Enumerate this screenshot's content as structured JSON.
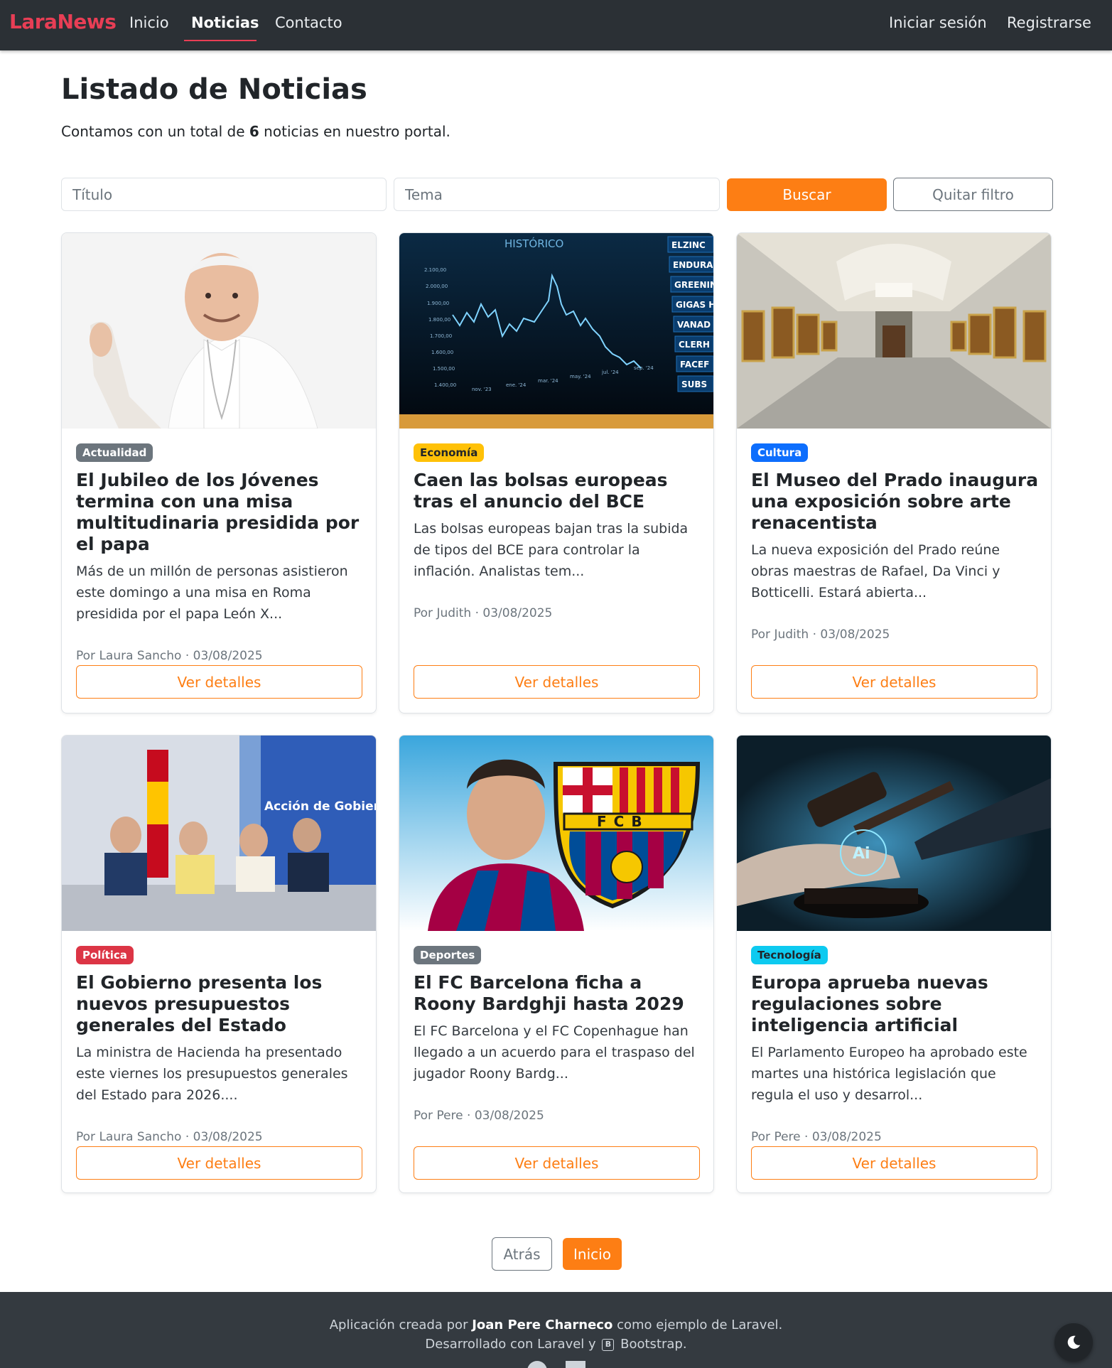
{
  "navbar": {
    "brand": "LaraNews",
    "links": [
      "Inicio",
      "Noticias",
      "Contacto"
    ],
    "active": "Noticias",
    "login": "Iniciar sesión",
    "register": "Registrarse",
    "accent_color": "#e83e55"
  },
  "header": {
    "title": "Listado de Noticias",
    "subtitle_before": "Contamos con un total de ",
    "count": "6",
    "subtitle_after": " noticias en nuestro portal."
  },
  "filter": {
    "title_placeholder": "Título",
    "topic_placeholder": "Tema",
    "search_label": "Buscar",
    "clear_label": "Quitar filtro"
  },
  "cards": [
    {
      "image": "pope-photo",
      "badge": "Actualidad",
      "badge_color": "#6c757d",
      "title": "El Jubileo de los Jóvenes termina con una misa multitudinaria presidida por el papa",
      "text": "Más de un millón de personas asistieron este domingo a una misa en Roma presidida por el papa León X...",
      "meta": "Por Laura Sancho · 03/08/2025",
      "button": "Ver detalles"
    },
    {
      "image": "stock-chart-photo",
      "badge": "Economía",
      "badge_color": "#ffc107",
      "title": "Caen las bolsas europeas tras el anuncio del BCE",
      "text": "Las bolsas europeas bajan tras la subida de tipos del BCE para controlar la inflación. Analistas tem...",
      "meta": "Por Judith · 03/08/2025",
      "button": "Ver detalles",
      "image_text": {
        "heading": "HISTÓRICO",
        "yticks": [
          "2.100,00",
          "2.000,00",
          "1.900,00",
          "1.800,00",
          "1.700,00",
          "1.600,00",
          "1.500,00",
          "1.400,00"
        ],
        "xticks": [
          "nov. '23",
          "ene. '24",
          "mar. '24",
          "may. '24",
          "jul. '24",
          "sep. '24"
        ],
        "tickers": [
          "ELZINC",
          "ENDURAN",
          "GREENIN",
          "GIGAS H",
          "VANAD",
          "CLERH",
          "FACEF",
          "SUBS"
        ]
      }
    },
    {
      "image": "museum-gallery-photo",
      "badge": "Cultura",
      "badge_color": "#0d6efd",
      "title": "El Museo del Prado inaugura una exposición sobre arte renacentista",
      "text": "La nueva exposición del Prado reúne obras maestras de Rafael, Da Vinci y Botticelli. Estará abierta...",
      "meta": "Por Judith · 03/08/2025",
      "button": "Ver detalles"
    },
    {
      "image": "government-press-photo",
      "badge": "Política",
      "badge_color": "#dc3545",
      "title": "El Gobierno presenta los nuevos presupuestos generales del Estado",
      "text": "La ministra de Hacienda ha presentado este viernes los presupuestos generales del Estado para 2026....",
      "meta": "Por Laura Sancho · 03/08/2025",
      "button": "Ver detalles",
      "image_text": {
        "sign": "Acción de Gobierno"
      }
    },
    {
      "image": "football-player-photo",
      "badge": "Deportes",
      "badge_color": "#6c757d",
      "title": "El FC Barcelona ficha a Roony Bardghji hasta 2029",
      "text": "El FC Barcelona y el FC Copenhague han llegado a un acuerdo para el traspaso del jugador Roony Bardg...",
      "meta": "Por Pere · 03/08/2025",
      "button": "Ver detalles",
      "image_text": {
        "crest": "FCB"
      }
    },
    {
      "image": "ai-gavel-photo",
      "badge": "Tecnología",
      "badge_color": "#0dcaf0",
      "title": "Europa aprueba nuevas regulaciones sobre inteligencia artificial",
      "text": "El Parlamento Europeo ha aprobado este martes una histórica legislación que regula el uso y desarrol...",
      "meta": "Por Pere · 03/08/2025",
      "button": "Ver detalles",
      "image_text": {
        "chip": "Ai"
      }
    }
  ],
  "pagination": {
    "back": "Atrás",
    "home": "Inicio"
  },
  "footer": {
    "line1_before": "Aplicación creada por ",
    "author": "Joan Pere Charneco",
    "line1_after": " como ejemplo de Laravel.",
    "line2_before": "Desarrollado con Laravel y ",
    "bootstrap_icon": "B",
    "line2_after": " Bootstrap."
  },
  "theme_toggle_icon": "moon-icon",
  "brand_color": "#fd7e14"
}
